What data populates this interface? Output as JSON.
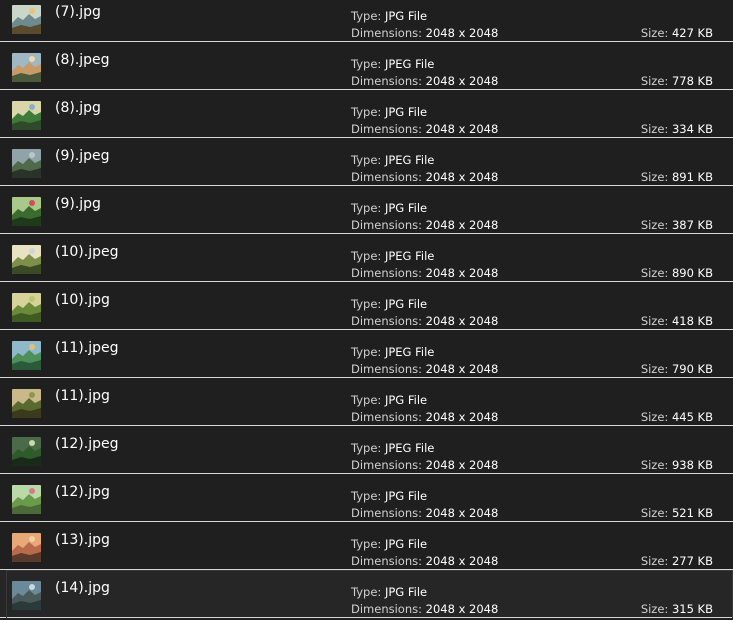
{
  "labels": {
    "type": "Type:",
    "dimensions": "Dimensions:",
    "size": "Size:"
  },
  "files": [
    {
      "name": "(7).jpg",
      "type": "JPG File",
      "dimensions": "2048 x 2048",
      "size": "427 KB",
      "thumb": {
        "sky": "#c9d6c8",
        "mid": "#6f8a8f",
        "ground": "#5a4a2e",
        "accent": "#e8c27a"
      }
    },
    {
      "name": "(8).jpeg",
      "type": "JPEG File",
      "dimensions": "2048 x 2048",
      "size": "778 KB",
      "thumb": {
        "sky": "#9fb8c4",
        "mid": "#c79a6a",
        "ground": "#4a5a3a",
        "accent": "#f1d9a8"
      }
    },
    {
      "name": "(8).jpg",
      "type": "JPG File",
      "dimensions": "2048 x 2048",
      "size": "334 KB",
      "thumb": {
        "sky": "#d9d7a9",
        "mid": "#3f7a3a",
        "ground": "#2f4a2a",
        "accent": "#8ab0c9"
      }
    },
    {
      "name": "(9).jpeg",
      "type": "JPEG File",
      "dimensions": "2048 x 2048",
      "size": "891 KB",
      "thumb": {
        "sky": "#8fa3a8",
        "mid": "#4e6a4a",
        "ground": "#2a332a",
        "accent": "#b9c7c9"
      }
    },
    {
      "name": "(9).jpg",
      "type": "JPG File",
      "dimensions": "2048 x 2048",
      "size": "387 KB",
      "thumb": {
        "sky": "#a9c98a",
        "mid": "#3b6b2e",
        "ground": "#1e3a1a",
        "accent": "#d9485a"
      }
    },
    {
      "name": "(10).jpeg",
      "type": "JPEG File",
      "dimensions": "2048 x 2048",
      "size": "890 KB",
      "thumb": {
        "sky": "#e8e1c2",
        "mid": "#7d8f4a",
        "ground": "#3a4a24",
        "accent": "#c9d7d9"
      }
    },
    {
      "name": "(10).jpg",
      "type": "JPG File",
      "dimensions": "2048 x 2048",
      "size": "418 KB",
      "thumb": {
        "sky": "#d6d29a",
        "mid": "#6a8a3a",
        "ground": "#3f5a22",
        "accent": "#b8c96a"
      }
    },
    {
      "name": "(11).jpeg",
      "type": "JPEG File",
      "dimensions": "2048 x 2048",
      "size": "790 KB",
      "thumb": {
        "sky": "#8fb9c9",
        "mid": "#4f8f5a",
        "ground": "#2a5a3a",
        "accent": "#e0c080"
      }
    },
    {
      "name": "(11).jpg",
      "type": "JPG File",
      "dimensions": "2048 x 2048",
      "size": "445 KB",
      "thumb": {
        "sky": "#c9b98a",
        "mid": "#5a6a2e",
        "ground": "#3a3a1e",
        "accent": "#8a9a4a"
      }
    },
    {
      "name": "(12).jpeg",
      "type": "JPEG File",
      "dimensions": "2048 x 2048",
      "size": "938 KB",
      "thumb": {
        "sky": "#4a6a4a",
        "mid": "#2f5a2a",
        "ground": "#1a2a1a",
        "accent": "#c9d9a8"
      }
    },
    {
      "name": "(12).jpg",
      "type": "JPG File",
      "dimensions": "2048 x 2048",
      "size": "521 KB",
      "thumb": {
        "sky": "#b9d9a8",
        "mid": "#6a9a4a",
        "ground": "#4a6a3a",
        "accent": "#d97a8a"
      }
    },
    {
      "name": "(13).jpg",
      "type": "JPG File",
      "dimensions": "2048 x 2048",
      "size": "277 KB",
      "thumb": {
        "sky": "#e8a878",
        "mid": "#b86a4a",
        "ground": "#5a3a2a",
        "accent": "#f4d0a0"
      }
    },
    {
      "name": "(14).jpg",
      "type": "JPG File",
      "dimensions": "2048 x 2048",
      "size": "315 KB",
      "thumb": {
        "sky": "#6a8a9a",
        "mid": "#4a5a5a",
        "ground": "#2a3a3a",
        "accent": "#c9d9e0"
      },
      "selected": true
    }
  ]
}
